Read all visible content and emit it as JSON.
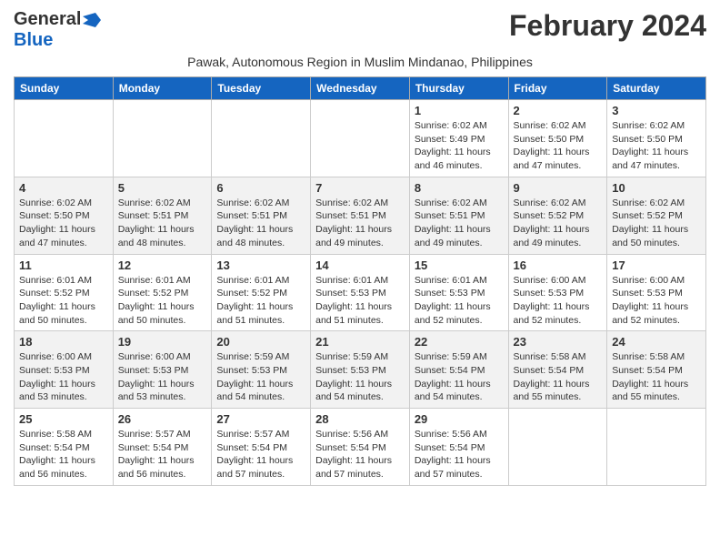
{
  "header": {
    "logo_general": "General",
    "logo_blue": "Blue",
    "month_title": "February 2024",
    "subtitle": "Pawak, Autonomous Region in Muslim Mindanao, Philippines"
  },
  "days_of_week": [
    "Sunday",
    "Monday",
    "Tuesday",
    "Wednesday",
    "Thursday",
    "Friday",
    "Saturday"
  ],
  "weeks": [
    {
      "row_class": "odd-row",
      "days": [
        {
          "day": "",
          "empty": true
        },
        {
          "day": "",
          "empty": true
        },
        {
          "day": "",
          "empty": true
        },
        {
          "day": "",
          "empty": true
        },
        {
          "day": "1",
          "sunrise": "Sunrise: 6:02 AM",
          "sunset": "Sunset: 5:49 PM",
          "daylight": "Daylight: 11 hours and 46 minutes."
        },
        {
          "day": "2",
          "sunrise": "Sunrise: 6:02 AM",
          "sunset": "Sunset: 5:50 PM",
          "daylight": "Daylight: 11 hours and 47 minutes."
        },
        {
          "day": "3",
          "sunrise": "Sunrise: 6:02 AM",
          "sunset": "Sunset: 5:50 PM",
          "daylight": "Daylight: 11 hours and 47 minutes."
        }
      ]
    },
    {
      "row_class": "even-row",
      "days": [
        {
          "day": "4",
          "sunrise": "Sunrise: 6:02 AM",
          "sunset": "Sunset: 5:50 PM",
          "daylight": "Daylight: 11 hours and 47 minutes."
        },
        {
          "day": "5",
          "sunrise": "Sunrise: 6:02 AM",
          "sunset": "Sunset: 5:51 PM",
          "daylight": "Daylight: 11 hours and 48 minutes."
        },
        {
          "day": "6",
          "sunrise": "Sunrise: 6:02 AM",
          "sunset": "Sunset: 5:51 PM",
          "daylight": "Daylight: 11 hours and 48 minutes."
        },
        {
          "day": "7",
          "sunrise": "Sunrise: 6:02 AM",
          "sunset": "Sunset: 5:51 PM",
          "daylight": "Daylight: 11 hours and 49 minutes."
        },
        {
          "day": "8",
          "sunrise": "Sunrise: 6:02 AM",
          "sunset": "Sunset: 5:51 PM",
          "daylight": "Daylight: 11 hours and 49 minutes."
        },
        {
          "day": "9",
          "sunrise": "Sunrise: 6:02 AM",
          "sunset": "Sunset: 5:52 PM",
          "daylight": "Daylight: 11 hours and 49 minutes."
        },
        {
          "day": "10",
          "sunrise": "Sunrise: 6:02 AM",
          "sunset": "Sunset: 5:52 PM",
          "daylight": "Daylight: 11 hours and 50 minutes."
        }
      ]
    },
    {
      "row_class": "odd-row",
      "days": [
        {
          "day": "11",
          "sunrise": "Sunrise: 6:01 AM",
          "sunset": "Sunset: 5:52 PM",
          "daylight": "Daylight: 11 hours and 50 minutes."
        },
        {
          "day": "12",
          "sunrise": "Sunrise: 6:01 AM",
          "sunset": "Sunset: 5:52 PM",
          "daylight": "Daylight: 11 hours and 50 minutes."
        },
        {
          "day": "13",
          "sunrise": "Sunrise: 6:01 AM",
          "sunset": "Sunset: 5:52 PM",
          "daylight": "Daylight: 11 hours and 51 minutes."
        },
        {
          "day": "14",
          "sunrise": "Sunrise: 6:01 AM",
          "sunset": "Sunset: 5:53 PM",
          "daylight": "Daylight: 11 hours and 51 minutes."
        },
        {
          "day": "15",
          "sunrise": "Sunrise: 6:01 AM",
          "sunset": "Sunset: 5:53 PM",
          "daylight": "Daylight: 11 hours and 52 minutes."
        },
        {
          "day": "16",
          "sunrise": "Sunrise: 6:00 AM",
          "sunset": "Sunset: 5:53 PM",
          "daylight": "Daylight: 11 hours and 52 minutes."
        },
        {
          "day": "17",
          "sunrise": "Sunrise: 6:00 AM",
          "sunset": "Sunset: 5:53 PM",
          "daylight": "Daylight: 11 hours and 52 minutes."
        }
      ]
    },
    {
      "row_class": "even-row",
      "days": [
        {
          "day": "18",
          "sunrise": "Sunrise: 6:00 AM",
          "sunset": "Sunset: 5:53 PM",
          "daylight": "Daylight: 11 hours and 53 minutes."
        },
        {
          "day": "19",
          "sunrise": "Sunrise: 6:00 AM",
          "sunset": "Sunset: 5:53 PM",
          "daylight": "Daylight: 11 hours and 53 minutes."
        },
        {
          "day": "20",
          "sunrise": "Sunrise: 5:59 AM",
          "sunset": "Sunset: 5:53 PM",
          "daylight": "Daylight: 11 hours and 54 minutes."
        },
        {
          "day": "21",
          "sunrise": "Sunrise: 5:59 AM",
          "sunset": "Sunset: 5:53 PM",
          "daylight": "Daylight: 11 hours and 54 minutes."
        },
        {
          "day": "22",
          "sunrise": "Sunrise: 5:59 AM",
          "sunset": "Sunset: 5:54 PM",
          "daylight": "Daylight: 11 hours and 54 minutes."
        },
        {
          "day": "23",
          "sunrise": "Sunrise: 5:58 AM",
          "sunset": "Sunset: 5:54 PM",
          "daylight": "Daylight: 11 hours and 55 minutes."
        },
        {
          "day": "24",
          "sunrise": "Sunrise: 5:58 AM",
          "sunset": "Sunset: 5:54 PM",
          "daylight": "Daylight: 11 hours and 55 minutes."
        }
      ]
    },
    {
      "row_class": "odd-row",
      "days": [
        {
          "day": "25",
          "sunrise": "Sunrise: 5:58 AM",
          "sunset": "Sunset: 5:54 PM",
          "daylight": "Daylight: 11 hours and 56 minutes."
        },
        {
          "day": "26",
          "sunrise": "Sunrise: 5:57 AM",
          "sunset": "Sunset: 5:54 PM",
          "daylight": "Daylight: 11 hours and 56 minutes."
        },
        {
          "day": "27",
          "sunrise": "Sunrise: 5:57 AM",
          "sunset": "Sunset: 5:54 PM",
          "daylight": "Daylight: 11 hours and 57 minutes."
        },
        {
          "day": "28",
          "sunrise": "Sunrise: 5:56 AM",
          "sunset": "Sunset: 5:54 PM",
          "daylight": "Daylight: 11 hours and 57 minutes."
        },
        {
          "day": "29",
          "sunrise": "Sunrise: 5:56 AM",
          "sunset": "Sunset: 5:54 PM",
          "daylight": "Daylight: 11 hours and 57 minutes."
        },
        {
          "day": "",
          "empty": true
        },
        {
          "day": "",
          "empty": true
        }
      ]
    }
  ]
}
